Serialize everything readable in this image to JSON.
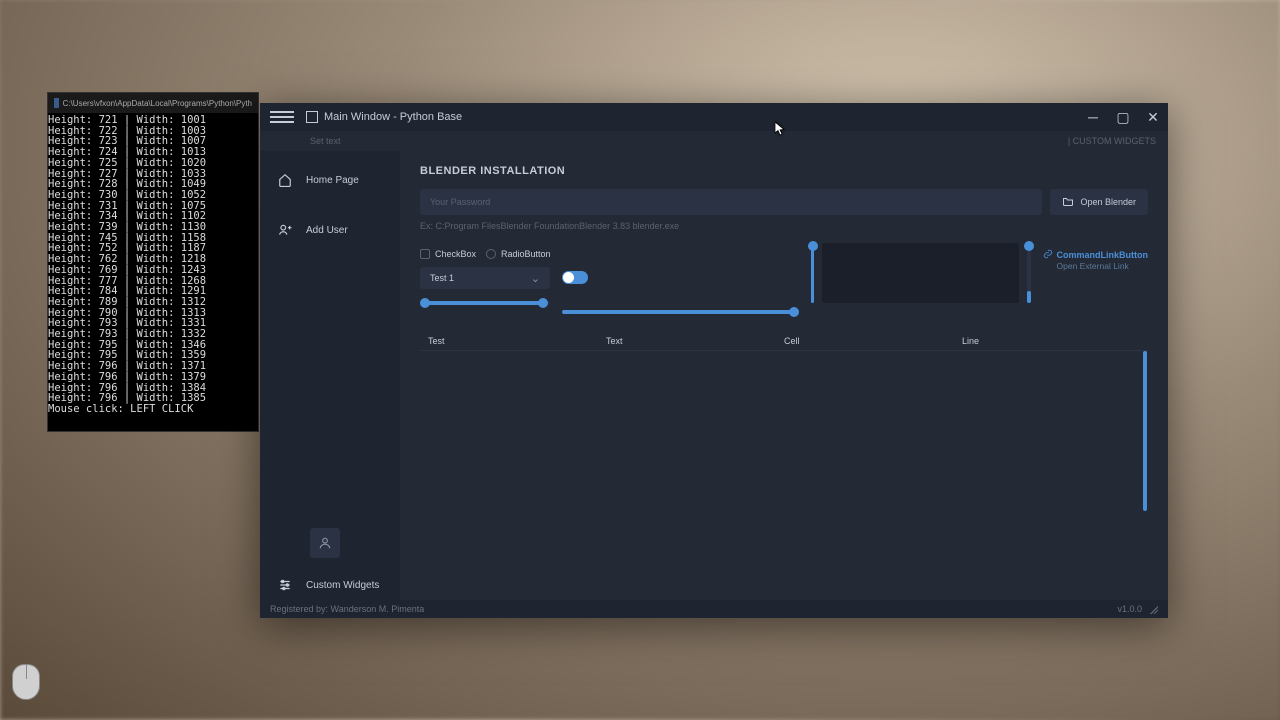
{
  "terminal": {
    "title": "C:\\Users\\vfxon\\AppData\\Local\\Programs\\Python\\Pyth",
    "lines": [
      "Height: 721 | Width: 1001",
      "Height: 722 | Width: 1003",
      "Height: 723 | Width: 1007",
      "Height: 724 | Width: 1013",
      "Height: 725 | Width: 1020",
      "Height: 727 | Width: 1033",
      "Height: 728 | Width: 1049",
      "Height: 730 | Width: 1052",
      "Height: 731 | Width: 1075",
      "Height: 734 | Width: 1102",
      "Height: 739 | Width: 1130",
      "Height: 745 | Width: 1158",
      "Height: 752 | Width: 1187",
      "Height: 762 | Width: 1218",
      "Height: 769 | Width: 1243",
      "Height: 777 | Width: 1268",
      "Height: 784 | Width: 1291",
      "Height: 789 | Width: 1312",
      "Height: 790 | Width: 1313",
      "Height: 793 | Width: 1331",
      "Height: 793 | Width: 1332",
      "Height: 795 | Width: 1346",
      "Height: 795 | Width: 1359",
      "Height: 796 | Width: 1371",
      "Height: 796 | Width: 1379",
      "Height: 796 | Width: 1384",
      "Height: 796 | Width: 1385",
      "Mouse click: LEFT CLICK"
    ]
  },
  "window": {
    "title": "Main Window - Python Base",
    "toolbar_text": "Set text",
    "toolbar_right": "| CUSTOM WIDGETS"
  },
  "sidebar": {
    "home": "Home Page",
    "add_user": "Add User",
    "custom_widgets": "Custom Widgets"
  },
  "content": {
    "section_title": "BLENDER INSTALLATION",
    "password_placeholder": "Your Password",
    "open_button": "Open Blender",
    "path_hint": "Ex: C:Program FilesBlender FoundationBlender 3.83 blender.exe",
    "checkbox": "CheckBox",
    "radio": "RadioButton",
    "combo_selected": "Test 1",
    "cmd_link_title": "CommandLinkButton",
    "cmd_link_sub": "Open External Link",
    "table_headers": {
      "c1": "Test",
      "c2": "Text",
      "c3": "Cell",
      "c4": "Line"
    }
  },
  "status": {
    "registered": "Registered by: Wanderson M. Pimenta",
    "version": "v1.0.0"
  },
  "colors": {
    "accent": "#4a90d8",
    "bg_dark": "#1e2430",
    "bg_panel": "#232935",
    "bg_input": "#2a3244"
  }
}
